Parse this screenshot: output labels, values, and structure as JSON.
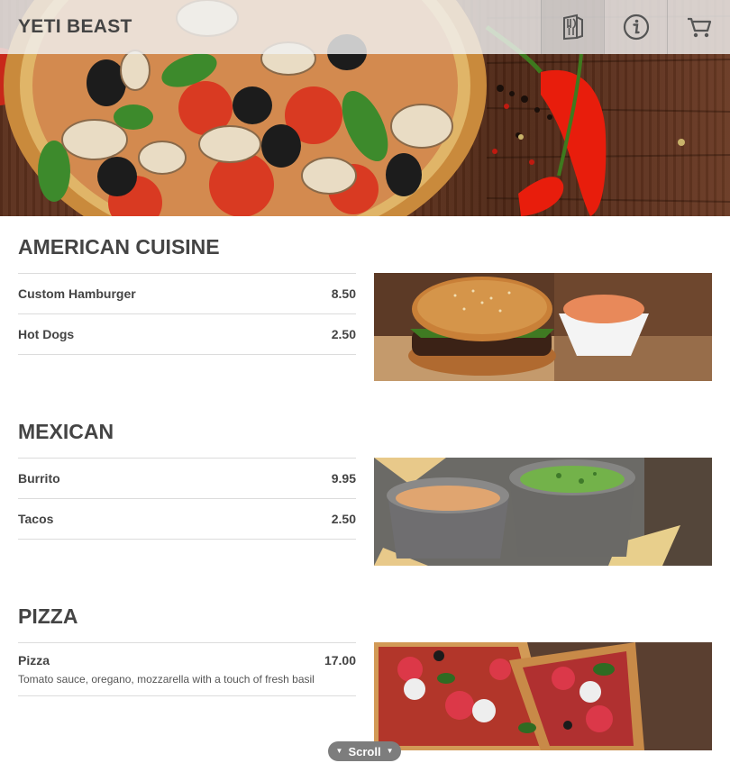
{
  "brand": {
    "name": "YETI BEAST"
  },
  "nav": {
    "menu_icon": "menu-book-icon",
    "info_icon": "info-icon",
    "cart_icon": "cart-icon"
  },
  "sections": [
    {
      "title": "AMERICAN CUISINE",
      "image": "burger-photo",
      "items": [
        {
          "name": "Custom Hamburger",
          "price": "8.50"
        },
        {
          "name": "Hot Dogs",
          "price": "2.50"
        }
      ]
    },
    {
      "title": "MEXICAN",
      "image": "dip-photo",
      "items": [
        {
          "name": "Burrito",
          "price": "9.95"
        },
        {
          "name": "Tacos",
          "price": "2.50"
        }
      ]
    },
    {
      "title": "PIZZA",
      "image": "pizza-photo",
      "items": [
        {
          "name": "Pizza",
          "price": "17.00",
          "description": "Tomato sauce, oregano, mozzarella with a touch of fresh basil"
        }
      ]
    }
  ],
  "scroll": {
    "label": "Scroll"
  },
  "colors": {
    "text": "#444444",
    "divider": "#dcdcdc",
    "scroll_pill": "#7d7d7d"
  }
}
